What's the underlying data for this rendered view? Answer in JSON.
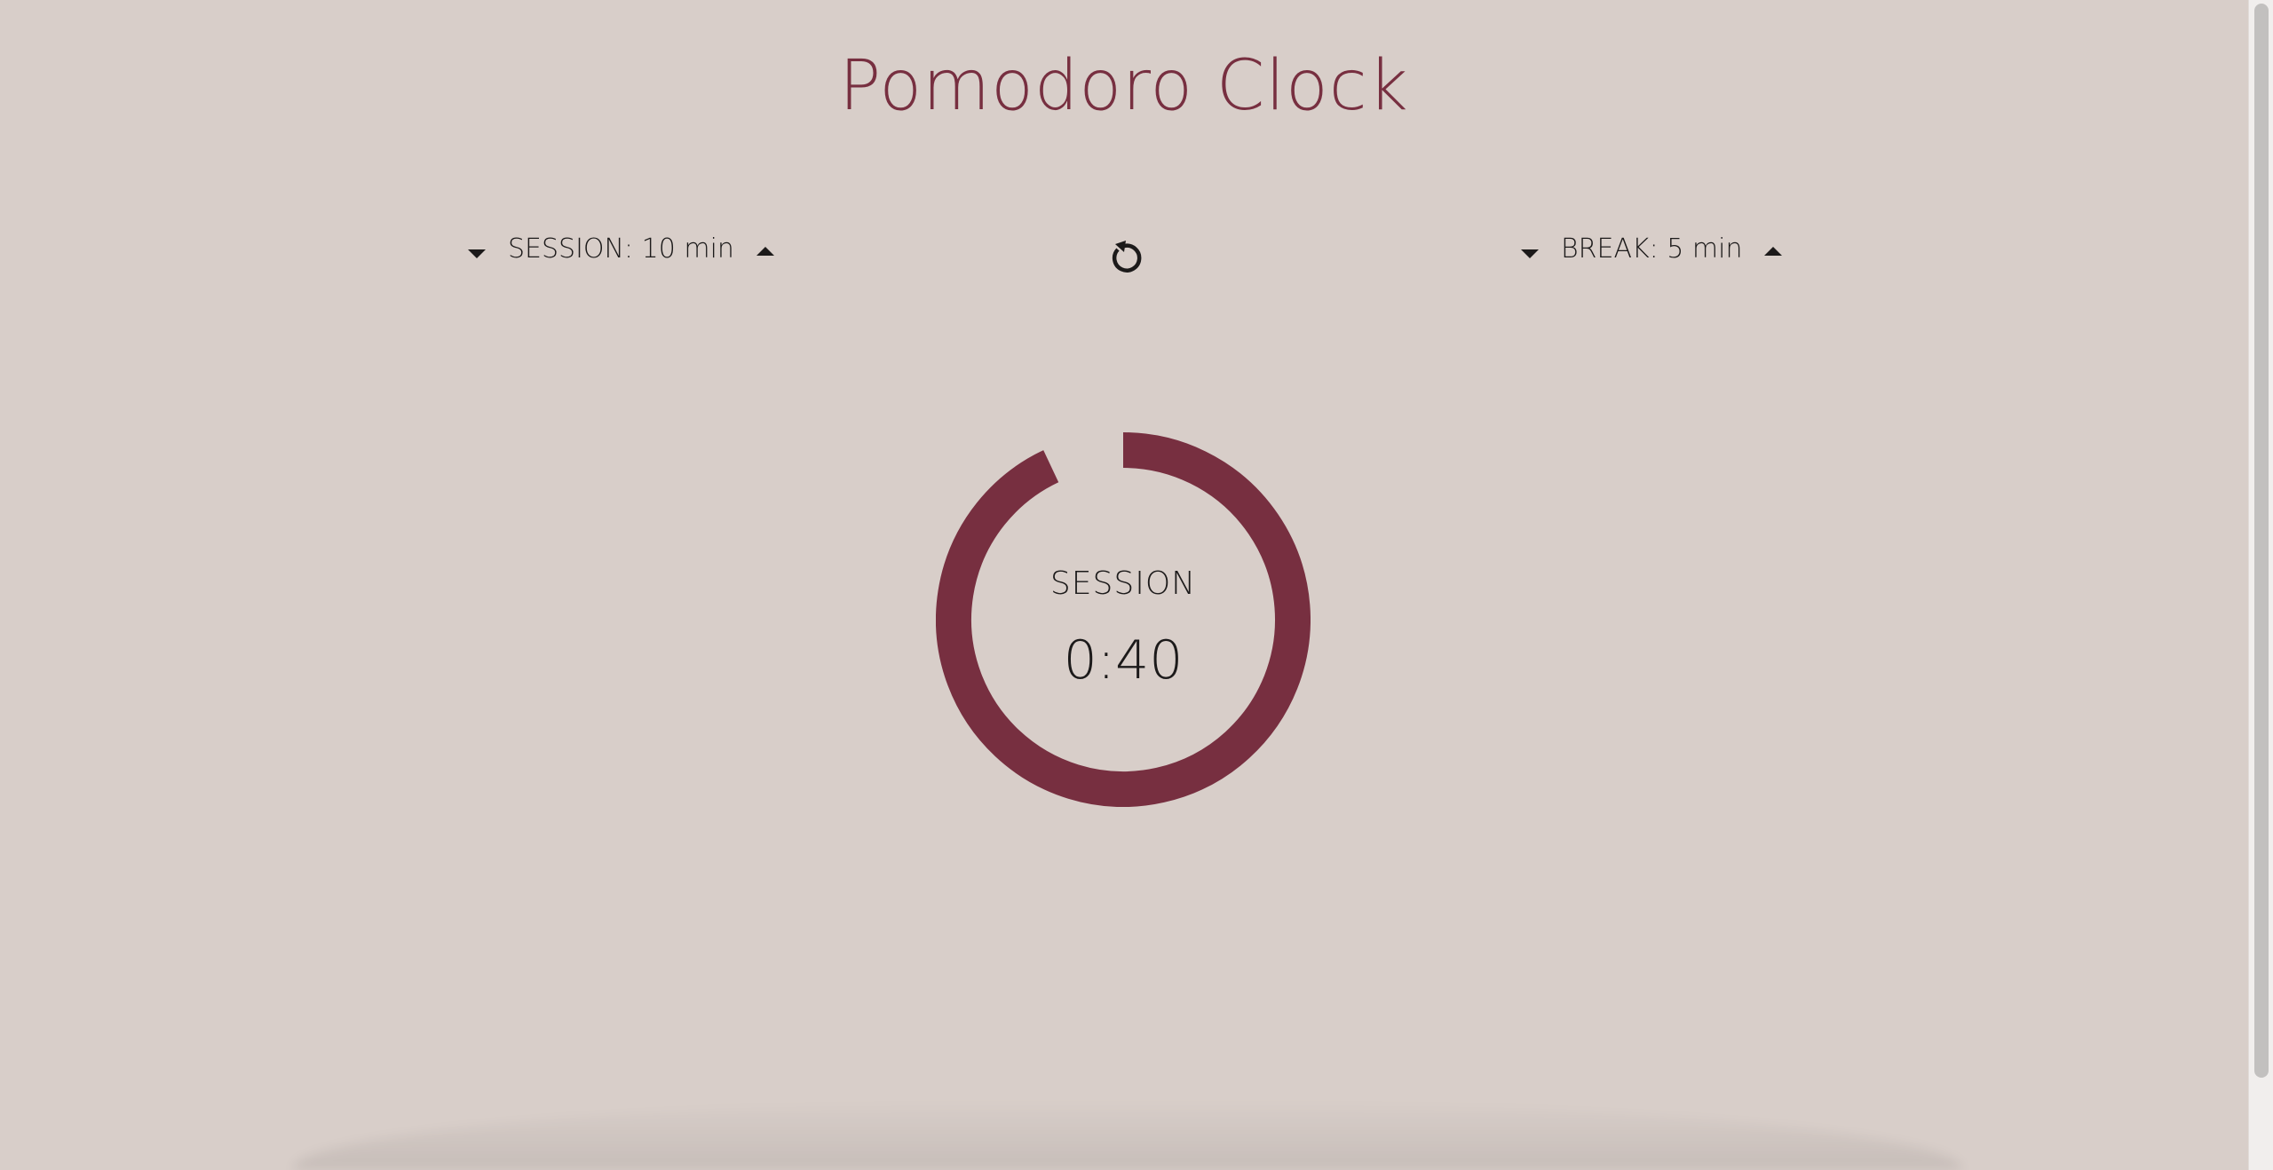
{
  "app": {
    "title": "Pomodoro Clock",
    "accent_color": "#772f40",
    "background_color": "#d8cec9"
  },
  "controls": {
    "session": {
      "label": "SESSION: 10 min",
      "decrease_icon": "caret-down-icon",
      "increase_icon": "caret-up-icon"
    },
    "reset": {
      "icon": "reset-icon"
    },
    "break": {
      "label": "BREAK: 5 min",
      "decrease_icon": "caret-down-icon",
      "increase_icon": "caret-up-icon"
    }
  },
  "timer": {
    "mode_label": "SESSION",
    "time": "0:40",
    "progress_remaining_fraction": 0.93
  }
}
